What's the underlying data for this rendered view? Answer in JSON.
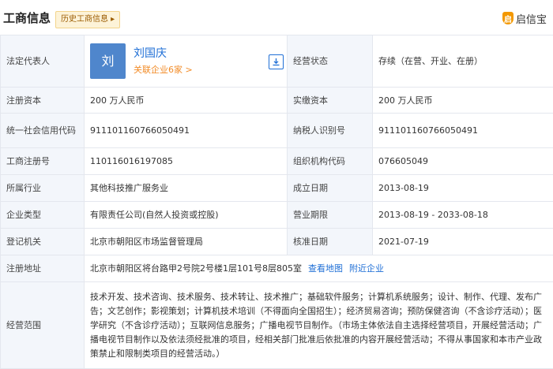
{
  "header": {
    "title": "工商信息",
    "history_tag": "历史工商信息 ▸",
    "brand_icon": "启",
    "brand_text": "启信宝"
  },
  "rows": {
    "legal_rep": {
      "label": "法定代表人",
      "avatar": "刘",
      "name": "刘国庆",
      "related": "关联企业6家 >",
      "status_label": "经营状态",
      "status_value": "存续（在营、开业、在册）"
    },
    "capital": {
      "label": "注册资本",
      "value": "200 万人民币",
      "label2": "实缴资本",
      "value2": "200 万人民币"
    },
    "credit": {
      "label": "统一社会信用代码",
      "value": "91110116076605049​1",
      "label2": "纳税人识别号",
      "value2": "911101160766050491"
    },
    "regno": {
      "label": "工商注册号",
      "value": "110116016197085",
      "label2": "组织机构代码",
      "value2": "076605049"
    },
    "industry": {
      "label": "所属行业",
      "value": "其他科技推广服务业",
      "label2": "成立日期",
      "value2": "2013-08-19"
    },
    "type": {
      "label": "企业类型",
      "value": "有限责任公司(自然人投资或控股)",
      "label2": "营业期限",
      "value2": "2013-08-19 - 2033-08-18"
    },
    "authority": {
      "label": "登记机关",
      "value": "北京市朝阳区市场监督管理局",
      "label2": "核准日期",
      "value2": "2021-07-19"
    },
    "address": {
      "label": "注册地址",
      "value": "北京市朝阳区将台路甲2号院2号楼1层101号8层805室",
      "map_link": "查看地图",
      "nearby_link": "附近企业"
    },
    "scope": {
      "label": "经营范围",
      "value": "技术开发、技术咨询、技术服务、技术转让、技术推广；基础软件服务；计算机系统服务；设计、制作、代理、发布广告；文艺创作；影视策划；计算机技术培训（不得面向全国招生）；经济贸易咨询；预防保健咨询（不含诊疗活动）；医学研究（不含诊疗活动）；互联网信息服务；广播电视节目制作。（市场主体依法自主选择经营项目，开展经营活动；广播电视节目制作以及依法须经批准的项目，经相关部门批准后依批准的内容开展经营活动；不得从事国家和本市产业政策禁止和限制类项目的经营活动。）"
    }
  },
  "icons": {
    "download": "download-icon"
  },
  "colors": {
    "link": "#1f6fd6",
    "accent": "#f28c28",
    "label_bg": "#f3f6fb",
    "border": "#e4e7ee"
  }
}
